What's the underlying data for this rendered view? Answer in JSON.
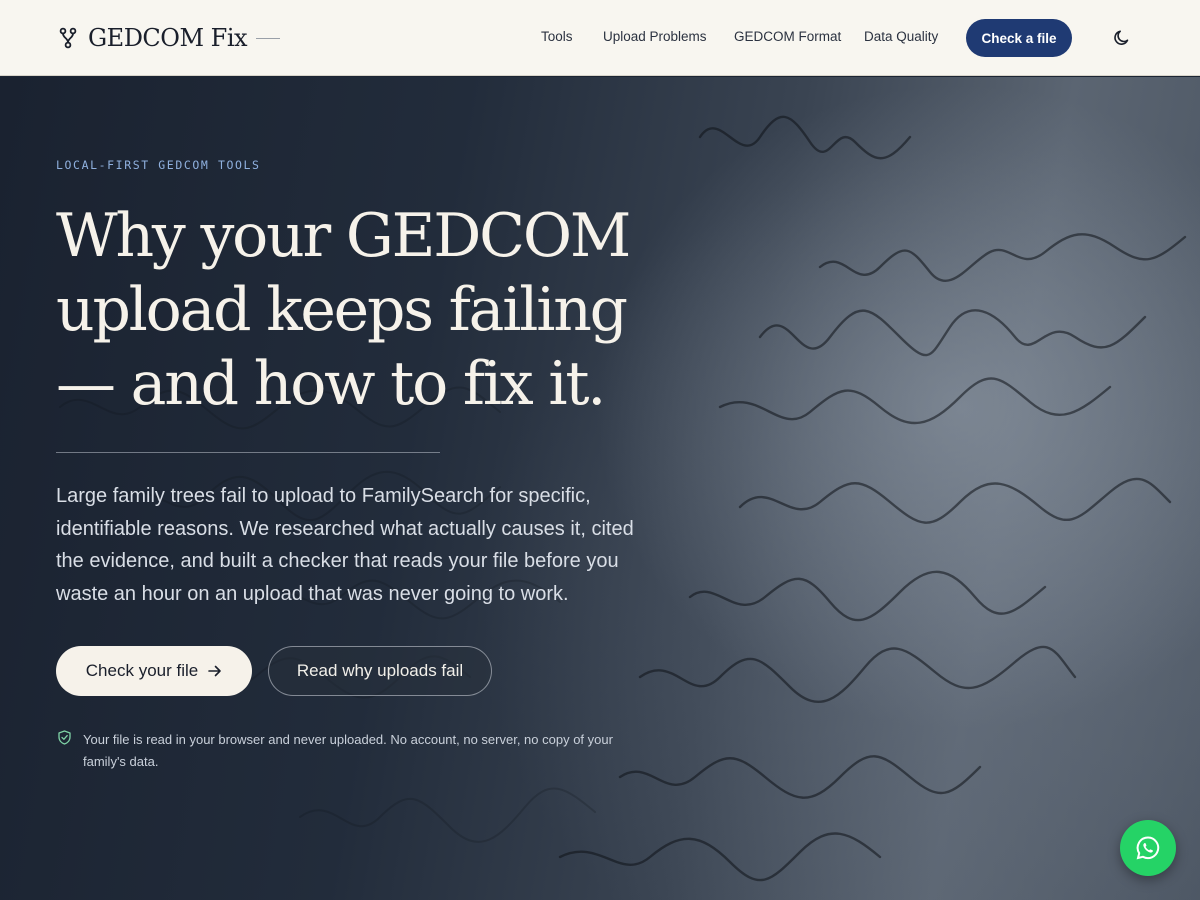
{
  "header": {
    "brand": "GEDCOM Fix",
    "nav": [
      "Tools",
      "Upload Problems",
      "GEDCOM Format",
      "Data Quality"
    ],
    "cta": "Check a file",
    "icons": {
      "logo": "branch-icon",
      "theme": "moon-icon"
    },
    "colors": {
      "accent": "#1f3a73",
      "background": "#f8f6f0"
    }
  },
  "hero": {
    "eyebrow": "LOCAL-FIRST GEDCOM TOOLS",
    "headline": [
      "Why your GEDCOM",
      "upload keeps failing",
      "— and how to fix it."
    ],
    "lede": "Large family trees fail to upload to FamilySearch for specific, identifiable reasons. We researched what actually causes it, cited the evidence, and built a checker that reads your file before you waste an hour on an upload that was never going to work.",
    "primary_button": "Check your file",
    "secondary_button": "Read why uploads fail",
    "privacy_note": "Your file is read in your browser and never uploaded. No account, no server, no copy of your family's data.",
    "icons": {
      "primary": "arrow-right-icon",
      "privacy": "shield-check-icon",
      "chat": "whatsapp-icon"
    }
  }
}
